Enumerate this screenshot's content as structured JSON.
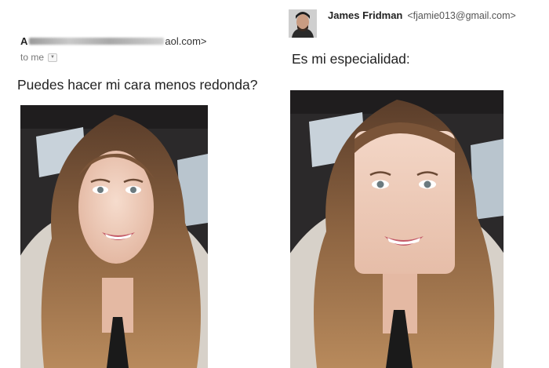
{
  "left_email": {
    "sender_initial": "A",
    "sender_domain_suffix": "aol.com>",
    "recipient_label": "to me",
    "dropdown_icon": "chevron-down-icon",
    "message": "Puedes hacer mi cara menos redonda?",
    "photo_icon": "selfie-photo"
  },
  "right_email": {
    "sender_name": "James Fridman",
    "sender_email": "<fjamie013@gmail.com>",
    "avatar_icon": "avatar-photo",
    "message": "Es mi especialidad:",
    "photo_icon": "edited-selfie-photo"
  },
  "colors": {
    "text": "#222222",
    "muted": "#777777",
    "hair": "#9a6b45",
    "skin": "#efc9b5",
    "car_interior": "#2c2a2b",
    "window": "#c9d3dc"
  }
}
